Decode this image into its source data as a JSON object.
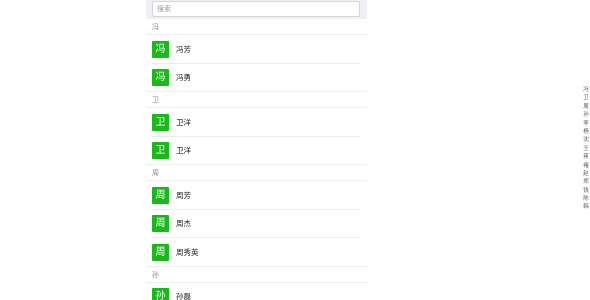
{
  "search": {
    "placeholder": "搜索"
  },
  "groups": [
    {
      "letter": "冯",
      "contacts": [
        {
          "initial": "冯",
          "name": "冯芳"
        },
        {
          "initial": "冯",
          "name": "冯勇"
        }
      ]
    },
    {
      "letter": "卫",
      "contacts": [
        {
          "initial": "卫",
          "name": "卫洋"
        },
        {
          "initial": "卫",
          "name": "卫洋"
        }
      ]
    },
    {
      "letter": "周",
      "contacts": [
        {
          "initial": "周",
          "name": "周芳"
        },
        {
          "initial": "周",
          "name": "周杰"
        },
        {
          "initial": "周",
          "name": "周秀英"
        }
      ]
    },
    {
      "letter": "孙",
      "contacts": [
        {
          "initial": "孙",
          "name": "孙磊"
        }
      ]
    }
  ],
  "index_bar": [
    "冯",
    "卫",
    "周",
    "孙",
    "李",
    "杨",
    "沈",
    "王",
    "蒋",
    "褚",
    "赵",
    "郑",
    "钱",
    "陈",
    "韩"
  ],
  "colors": {
    "avatar_bg": "#1ab81a",
    "search_bg": "#efeff4"
  }
}
